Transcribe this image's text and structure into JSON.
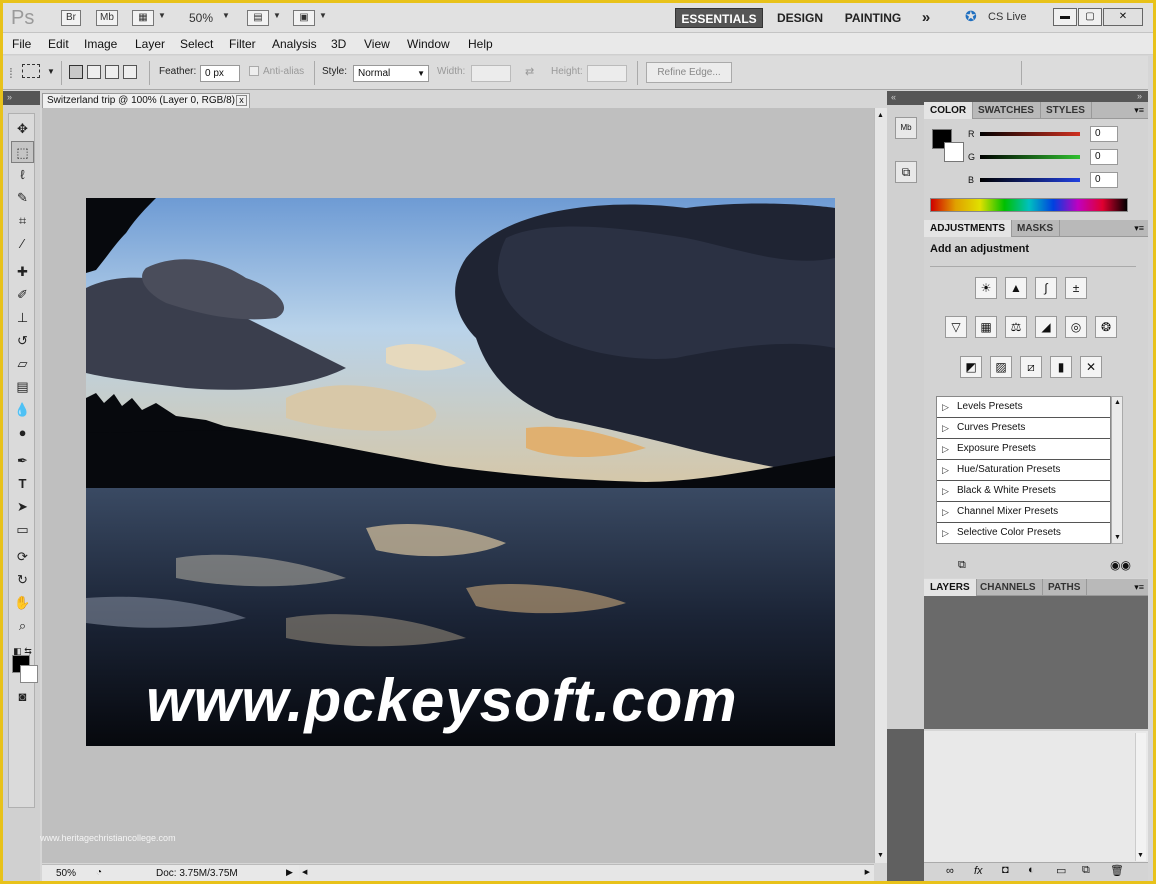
{
  "titlebar": {
    "logo": "Ps",
    "bridge_label": "Br",
    "minibridge_label": "Mb",
    "zoom_value": "50%",
    "workspaces": [
      "ESSENTIALS",
      "DESIGN",
      "PAINTING"
    ],
    "more_label": "»",
    "cslive_label": "CS Live"
  },
  "menu": [
    "File",
    "Edit",
    "Image",
    "Layer",
    "Select",
    "Filter",
    "Analysis",
    "3D",
    "View",
    "Window",
    "Help"
  ],
  "options": {
    "feather_label": "Feather:",
    "feather_value": "0 px",
    "antialias_label": "Anti-alias",
    "style_label": "Style:",
    "style_value": "Normal",
    "width_label": "Width:",
    "height_label": "Height:",
    "refine_label": "Refine Edge..."
  },
  "document": {
    "tab_title": "Switzerland trip @ 100% (Layer 0, RGB/8)",
    "tab_close": "x",
    "watermark": "www.pckeysoft.com",
    "credit": "www.heritagechristiancollege.com"
  },
  "status": {
    "zoom": "50%",
    "doc_info": "Doc: 3.75M/3.75M"
  },
  "color_panel": {
    "tabs": [
      "COLOR",
      "SWATCHES",
      "STYLES"
    ],
    "channels": [
      {
        "label": "R",
        "value": "0",
        "color": "#c0302a"
      },
      {
        "label": "G",
        "value": "0",
        "color": "#3aa63a"
      },
      {
        "label": "B",
        "value": "0",
        "color": "#2040c0"
      }
    ]
  },
  "adjustments_panel": {
    "tabs": [
      "ADJUSTMENTS",
      "MASKS"
    ],
    "heading": "Add an adjustment",
    "presets": [
      "Levels Presets",
      "Curves Presets",
      "Exposure Presets",
      "Hue/Saturation Presets",
      "Black & White Presets",
      "Channel Mixer Presets",
      "Selective Color Presets"
    ]
  },
  "layers_panel": {
    "tabs": [
      "LAYERS",
      "CHANNELS",
      "PATHS"
    ]
  },
  "colors": {
    "frame": "#e8c21a",
    "panel_dark": "#565656"
  }
}
